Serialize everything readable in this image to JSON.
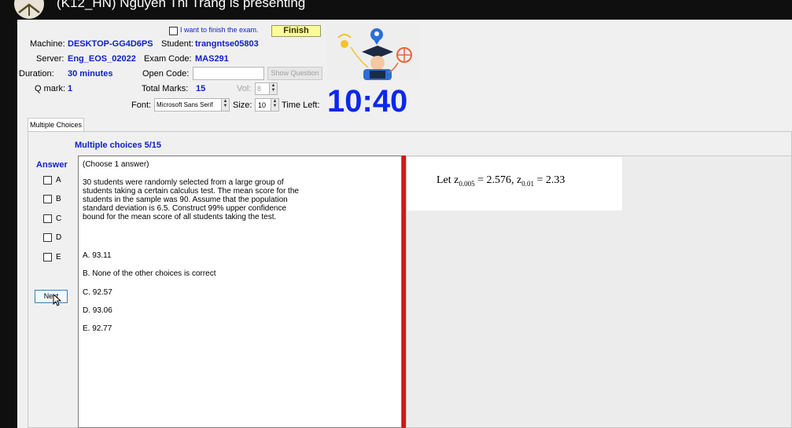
{
  "meeting": {
    "presenter_title": "(K12_HN) Nguyen Thi Trang is presenting"
  },
  "exam": {
    "finish_checkbox_label": "I want to finish the exam.",
    "finish_button": "Finish",
    "machine_label": "Machine:",
    "machine_value": "DESKTOP-GG4D6PS",
    "student_label": "Student:",
    "student_value": "trangntse05803",
    "server_label": "Server:",
    "server_value": "Eng_EOS_02022",
    "exam_code_label": "Exam Code:",
    "exam_code_value": "MAS291",
    "duration_label": "Duration:",
    "duration_value": "30 minutes",
    "open_code_label": "Open Code:",
    "open_code_value": "",
    "show_question_button": "Show Question",
    "qmark_label": "Q mark:",
    "qmark_value": "1",
    "total_marks_label": "Total Marks:",
    "total_marks_value": "15",
    "vol_label": "Vol:",
    "vol_value": "8",
    "font_label": "Font:",
    "font_value": "Microsoft Sans Serif",
    "size_label": "Size:",
    "size_value": "10",
    "time_left_label": "Time Left:",
    "timer": "10:40",
    "tab_label": "Multiple Choices",
    "mc_title": "Multiple choices 5/15",
    "answer_header": "Answer",
    "answer_options": [
      "A",
      "B",
      "C",
      "D",
      "E"
    ],
    "next_button": "Next",
    "question": {
      "instruction": "(Choose 1 answer)",
      "stem_lines": [
        "30 students were randomly selected from a large group of",
        "students taking a certain calculus test. The mean score for the",
        "students in the sample was 90. Assume that the population",
        "standard deviation is 6.5. Construct 99%  upper confidence",
        "bound for the mean score of all students taking the test."
      ],
      "choices": [
        "A. 93.11",
        "B. None of the other choices is correct",
        "C. 92.57",
        "D. 93.06",
        "E. 92.77"
      ]
    },
    "formula": {
      "prefix": "Let  z",
      "sub1": "0.005",
      "mid": " = 2.576, z",
      "sub2": "0.01",
      "suffix": " = 2.33"
    }
  },
  "colors": {
    "accent_blue": "#1020c8",
    "timer_blue": "#0c27f0",
    "finish_yellow": "#fbfb9a",
    "divider_red": "#d41717"
  }
}
